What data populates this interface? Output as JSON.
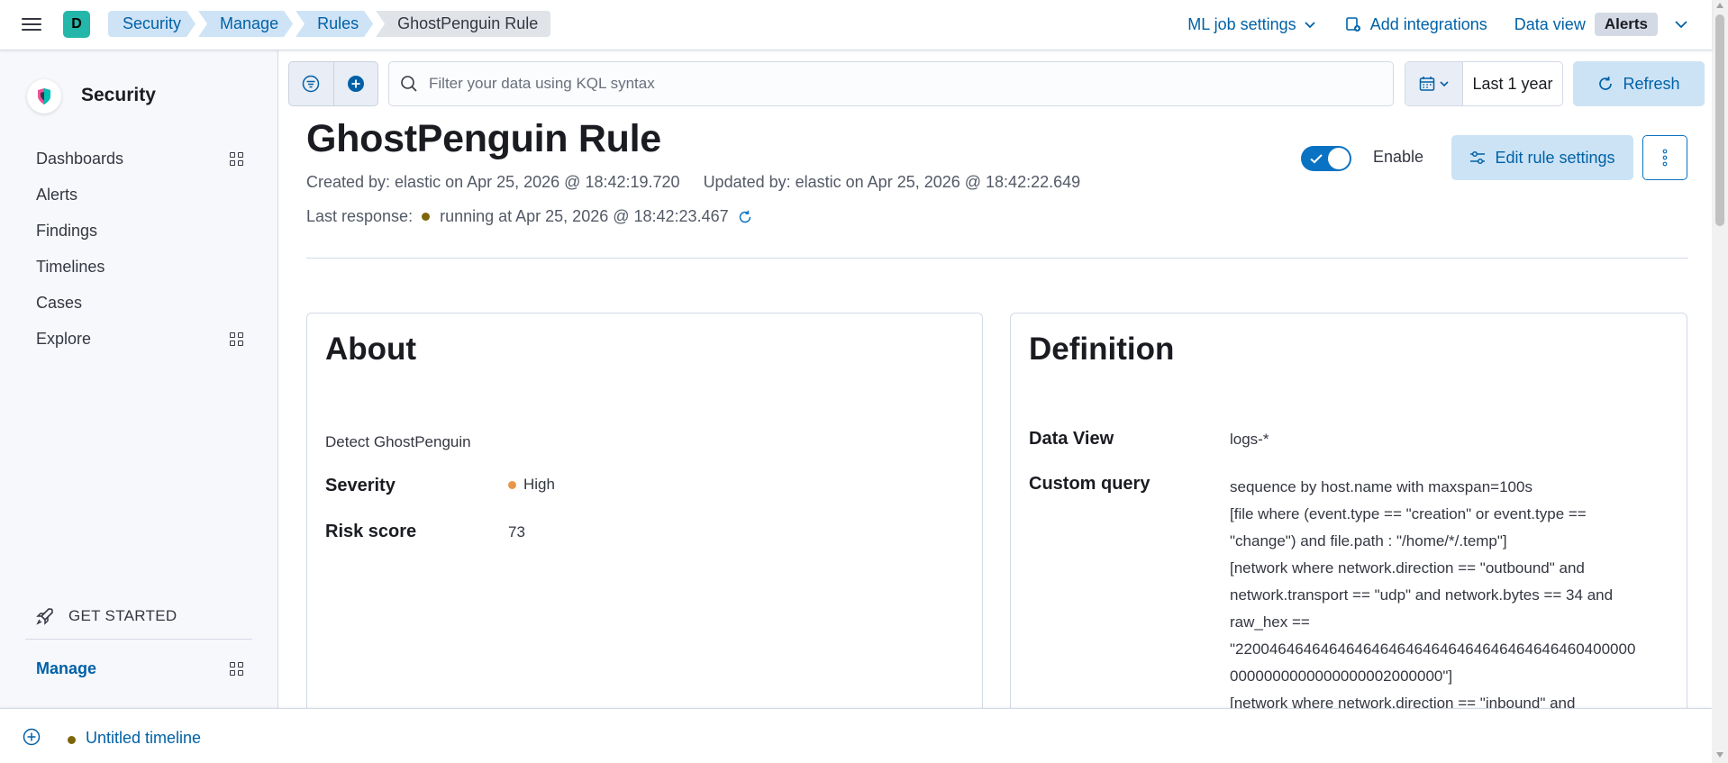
{
  "header": {
    "space_initial": "D",
    "breadcrumbs": [
      "Security",
      "Manage",
      "Rules",
      "GhostPenguin Rule"
    ],
    "ml_job_settings": "ML job settings",
    "add_integrations": "Add integrations",
    "data_view_label": "Data view",
    "data_view_value": "Alerts"
  },
  "sidebar": {
    "title": "Security",
    "items": [
      {
        "label": "Dashboards",
        "icon": "grid-icon"
      },
      {
        "label": "Alerts"
      },
      {
        "label": "Findings"
      },
      {
        "label": "Timelines"
      },
      {
        "label": "Cases"
      },
      {
        "label": "Explore",
        "icon": "grid-icon"
      }
    ],
    "get_started": "GET STARTED",
    "manage": "Manage"
  },
  "query_bar": {
    "placeholder": "Filter your data using KQL syntax",
    "date_range": "Last 1 year",
    "refresh": "Refresh"
  },
  "rule": {
    "title": "GhostPenguin Rule",
    "created": "Created by: elastic on Apr 25, 2026 @ 18:42:19.720",
    "updated": "Updated by: elastic on Apr 25, 2026 @ 18:42:22.649",
    "last_response_label": "Last response:",
    "last_response_value": "running at Apr 25, 2026 @ 18:42:23.467",
    "enable_label": "Enable",
    "enabled": true,
    "edit_settings": "Edit rule settings"
  },
  "about": {
    "title": "About",
    "description": "Detect GhostPenguin",
    "severity_label": "Severity",
    "severity_value": "High",
    "severity_color": "#e7974b",
    "risk_label": "Risk score",
    "risk_value": "73"
  },
  "definition": {
    "title": "Definition",
    "data_view_label": "Data View",
    "data_view_value": "logs-*",
    "custom_query_label": "Custom query",
    "query_lines": [
      "sequence by host.name with maxspan=100s",
      "[file where (event.type == \"creation\" or event.type ==",
      "\"change\") and file.path : \"/home/*/.temp\"]",
      "[network where network.direction == \"outbound\" and",
      "network.transport == \"udp\" and network.bytes == 34 and",
      "raw_hex ==",
      "\"22004646464646464646464646464646464646460400000",
      "0000000000000000002000000\"]",
      "[network where network.direction == \"inbound\" and"
    ]
  },
  "timeline": {
    "label": "Untitled timeline"
  }
}
